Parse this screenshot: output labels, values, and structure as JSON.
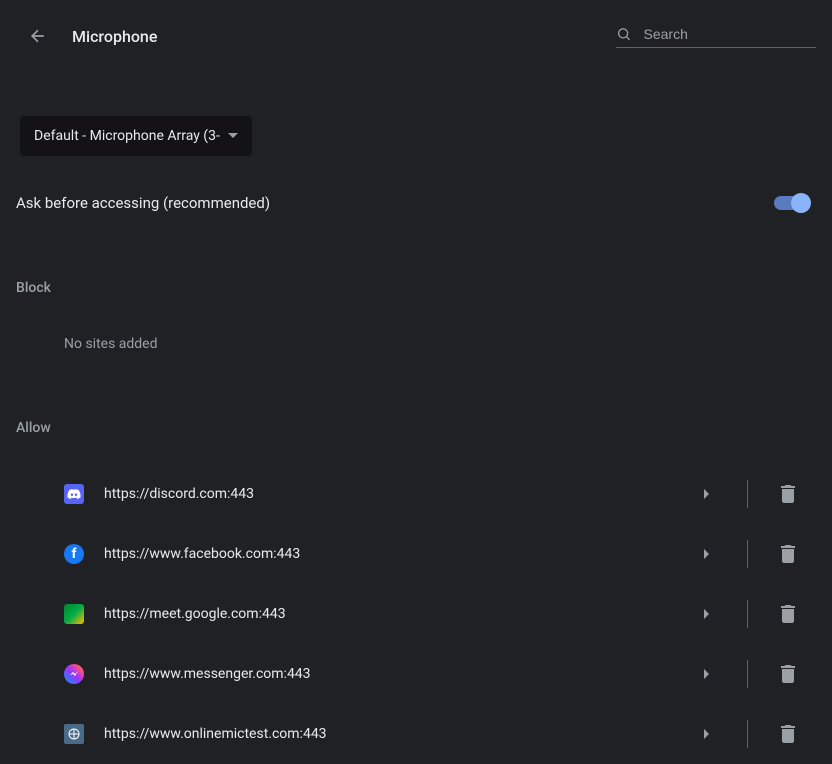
{
  "header": {
    "title": "Microphone",
    "search_placeholder": "Search"
  },
  "device": {
    "selected": "Default - Microphone Array (3-"
  },
  "ask_setting": {
    "label": "Ask before accessing (recommended)",
    "enabled": true
  },
  "block_section": {
    "title": "Block",
    "empty_message": "No sites added"
  },
  "allow_section": {
    "title": "Allow",
    "sites": [
      {
        "url": "https://discord.com:443",
        "icon": "discord"
      },
      {
        "url": "https://www.facebook.com:443",
        "icon": "facebook"
      },
      {
        "url": "https://meet.google.com:443",
        "icon": "meet"
      },
      {
        "url": "https://www.messenger.com:443",
        "icon": "messenger"
      },
      {
        "url": "https://www.onlinemictest.com:443",
        "icon": "mictest"
      }
    ]
  }
}
